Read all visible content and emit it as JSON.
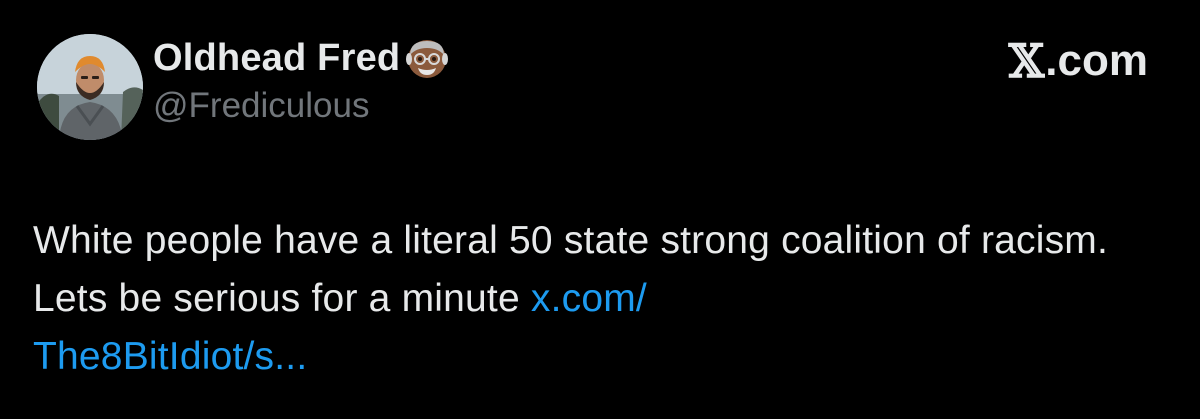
{
  "author": {
    "display_name": "Oldhead Fred",
    "handle": "@Frediculous",
    "badge_emoji": "old-man-dark-skin-emoji"
  },
  "brand": {
    "glyph": "𝕏",
    "label": ".com"
  },
  "tweet": {
    "text": "White people have a literal 50 state strong coalition of racism. Lets be serious for a minute ",
    "link_line1": "x.com/",
    "link_line2": "The8BitIdiot/s..."
  },
  "colors": {
    "background": "#000000",
    "text_primary": "#e7e9ea",
    "text_secondary": "#71767b",
    "link": "#1d9bf0"
  },
  "icons": {
    "avatar": "profile-photo",
    "brand": "x-logo-icon"
  }
}
